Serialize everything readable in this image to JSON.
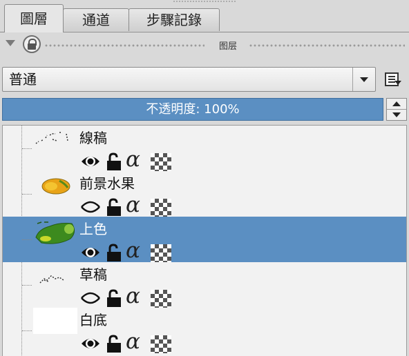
{
  "tabs": [
    {
      "label": "圖層",
      "active": true
    },
    {
      "label": "通道",
      "active": false
    },
    {
      "label": "步驟記錄",
      "active": false
    }
  ],
  "lock_row": {
    "label": "图层"
  },
  "blend_mode": {
    "value": "普通"
  },
  "opacity": {
    "text": "不透明度: 100%",
    "value": 100
  },
  "layers": [
    {
      "name": "線稿",
      "visible": true,
      "selected": false,
      "thumb": "lineart-icon"
    },
    {
      "name": "前景水果",
      "visible": false,
      "selected": false,
      "thumb": "orange-slice-icon"
    },
    {
      "name": "上色",
      "visible": true,
      "selected": true,
      "thumb": "green-fruit-icon"
    },
    {
      "name": "草稿",
      "visible": false,
      "selected": false,
      "thumb": "sketch-icon"
    },
    {
      "name": "白底",
      "visible": true,
      "selected": false,
      "thumb": "white-fill-icon"
    }
  ],
  "colors": {
    "accent": "#5b8fc2",
    "panel": "#d9d9d9",
    "list_bg": "#f2f2f2"
  }
}
